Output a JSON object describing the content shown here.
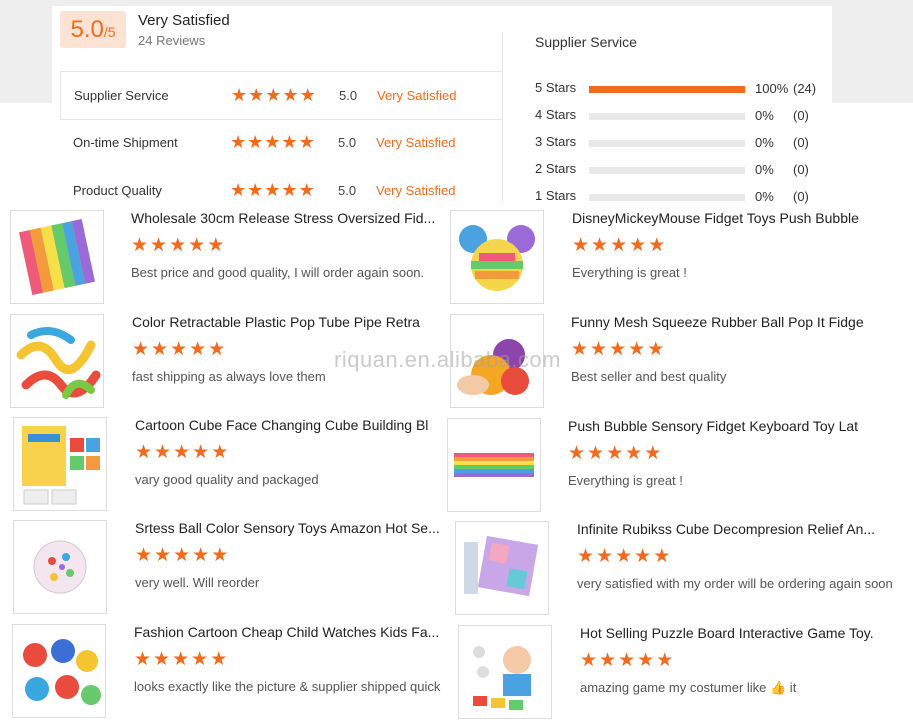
{
  "summary": {
    "score": "5.0",
    "score_max": "/5",
    "title": "Very Satisfied",
    "reviews": "24 Reviews"
  },
  "ratings": [
    {
      "label": "Supplier Service",
      "stars": 5,
      "value": "5.0",
      "status": "Very Satisfied"
    },
    {
      "label": "On-time Shipment",
      "stars": 5,
      "value": "5.0",
      "status": "Very Satisfied"
    },
    {
      "label": "Product Quality",
      "stars": 5,
      "value": "5.0",
      "status": "Very Satisfied"
    }
  ],
  "distribution": {
    "title": "Supplier Service",
    "rows": [
      {
        "label": "5 Stars",
        "fraction": 1.0,
        "percent": "100%",
        "count": "(24)"
      },
      {
        "label": "4 Stars",
        "fraction": 0,
        "percent": "0%",
        "count": "(0)"
      },
      {
        "label": "3 Stars",
        "fraction": 0,
        "percent": "0%",
        "count": "(0)"
      },
      {
        "label": "2 Stars",
        "fraction": 0,
        "percent": "0%",
        "count": "(0)"
      },
      {
        "label": "1 Stars",
        "fraction": 0,
        "percent": "0%",
        "count": "(0)"
      }
    ]
  },
  "reviews": [
    {
      "title": "Wholesale 30cm Release Stress Oversized Fid...",
      "stars": 5,
      "text": "Best price and good quality, I will order again soon."
    },
    {
      "title": "DisneyMickeyMouse Fidget Toys Push Bubble",
      "stars": 5,
      "text": "Everything is great !"
    },
    {
      "title": "Color Retractable Plastic Pop Tube Pipe Retra",
      "stars": 5,
      "text": "fast shipping as always love them"
    },
    {
      "title": "Funny Mesh Squeeze Rubber Ball Pop It Fidge",
      "stars": 5,
      "text": "Best seller and best quality"
    },
    {
      "title": "Cartoon Cube Face Changing Cube Building Bl",
      "stars": 5,
      "text": "vary good quality and packaged"
    },
    {
      "title": "Push Bubble Sensory Fidget Keyboard Toy Lat",
      "stars": 5,
      "text": "Everything is great !"
    },
    {
      "title": "Srtess Ball Color Sensory Toys Amazon Hot Se...",
      "stars": 5,
      "text": "very well.  Will reorder"
    },
    {
      "title": "Infinite Rubikss Cube Decompresion Relief An...",
      "stars": 5,
      "text": "very satisfied with my order will be ordering again soon"
    },
    {
      "title": "Fashion Cartoon Cheap Child Watches Kids Fa...",
      "stars": 5,
      "text": "looks exactly like the picture & supplier shipped quick"
    },
    {
      "title": "Hot Selling Puzzle Board Interactive Game Toy.",
      "stars": 5,
      "text": "amazing game my costumer like 👍 it"
    }
  ],
  "watermark": "riquan.en.alibaba.com",
  "colors": {
    "accent": "#f26b1d",
    "score_bg": "#fde3d3",
    "track": "#e9e9e9"
  }
}
